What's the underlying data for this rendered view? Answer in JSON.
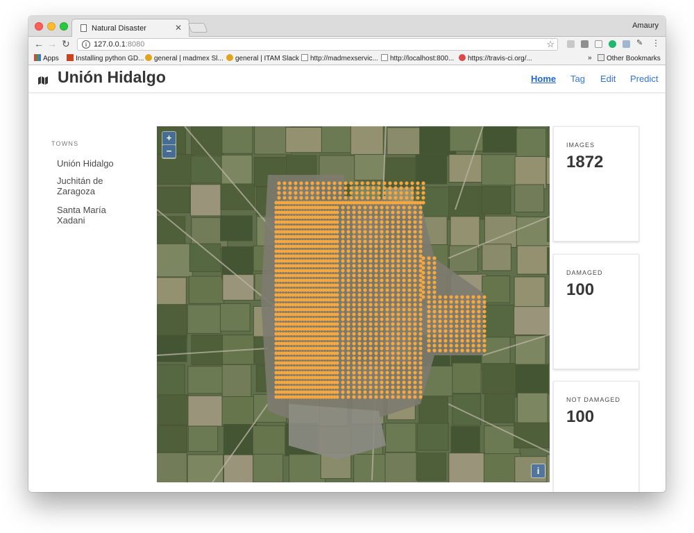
{
  "browser": {
    "tab_title": "Natural Disaster",
    "profile_name": "Amaury",
    "url_host": "127.0.0.1",
    "url_port": ":8080",
    "bookmarks": [
      {
        "label": "Apps",
        "icon": "apps-grid-icon",
        "color": "#e0433a"
      },
      {
        "label": "Installing python GD...",
        "icon": "bookmark-favicon-icon",
        "color": "#d9541e"
      },
      {
        "label": "general | madmex Sl...",
        "icon": "slack-icon",
        "color": "#e3a31a"
      },
      {
        "label": "general | ITAM Slack",
        "icon": "slack-icon",
        "color": "#e3a31a"
      },
      {
        "label": "http://madmexservic...",
        "icon": "page-icon",
        "color": "#888888"
      },
      {
        "label": "http://localhost:800...",
        "icon": "page-icon",
        "color": "#888888"
      },
      {
        "label": "https://travis-ci.org/...",
        "icon": "travis-icon",
        "color": "#d94a4a"
      }
    ],
    "bookmarks_overflow": "»",
    "other_bookmarks": "Other Bookmarks"
  },
  "navbar": {
    "title": "Unión Hidalgo",
    "links": [
      "Home",
      "Tag",
      "Edit",
      "Predict"
    ],
    "active": "Home"
  },
  "sidebar": {
    "label": "TOWNS",
    "towns": [
      "Unión Hidalgo",
      "Juchitán de Zaragoza",
      "Santa María Xadani"
    ]
  },
  "map": {
    "zoom_in": "+",
    "zoom_out": "−",
    "attribution": "i",
    "marker_color": "#f7a740"
  },
  "stats": {
    "images": {
      "label": "IMAGES",
      "value": "1872"
    },
    "damaged": {
      "label": "DAMAGED",
      "value": "100"
    },
    "not_damaged": {
      "label": "NOT DAMAGED",
      "value": "100"
    }
  },
  "colors": {
    "link": "#3273dc",
    "title": "#363636"
  }
}
